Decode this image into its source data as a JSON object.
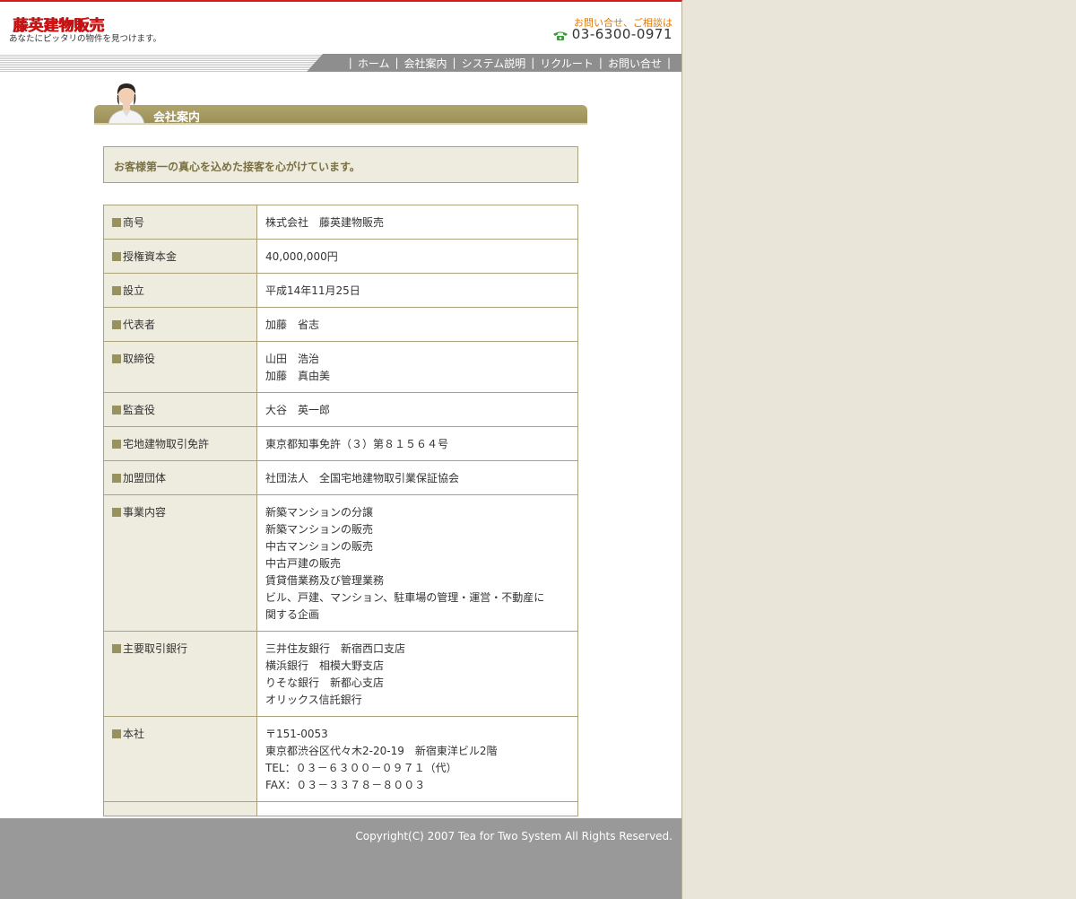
{
  "header": {
    "logo": "藤英建物販売",
    "tagline": "あなたにピッタリの物件を見つけます。",
    "contact_label": "お問い合せ、ご相談は",
    "phone": "03-6300-0971"
  },
  "nav": {
    "items": [
      {
        "label": "ホーム"
      },
      {
        "label": "会社案内"
      },
      {
        "label": "システム説明"
      },
      {
        "label": "リクルート"
      },
      {
        "label": "お問い合せ"
      }
    ]
  },
  "section": {
    "title": "会社案内",
    "intro": "お客様第一の真心を込めた接客を心がけています。"
  },
  "company": {
    "rows": [
      {
        "label": "商号",
        "lines": [
          "株式会社　藤英建物販売"
        ]
      },
      {
        "label": "授権資本金",
        "lines": [
          "40,000,000円"
        ]
      },
      {
        "label": "設立",
        "lines": [
          "平成14年11月25日"
        ]
      },
      {
        "label": "代表者",
        "lines": [
          "加藤　省志"
        ]
      },
      {
        "label": "取締役",
        "lines": [
          "山田　浩治",
          "加藤　真由美"
        ]
      },
      {
        "label": "監査役",
        "lines": [
          "大谷　英一郎"
        ]
      },
      {
        "label": "宅地建物取引免許",
        "lines": [
          "東京都知事免許（３）第８１５６４号"
        ]
      },
      {
        "label": "加盟団体",
        "lines": [
          "社団法人　全国宅地建物取引業保証協会"
        ]
      },
      {
        "label": "事業内容",
        "lines": [
          "新築マンションの分譲",
          "新築マンションの販売",
          "中古マンションの販売",
          "中古戸建の販売",
          "賃貸借業務及び管理業務",
          "ビル、戸建、マンション、駐車場の管理・運営・不動産に",
          "関する企画"
        ]
      },
      {
        "label": "主要取引銀行",
        "lines": [
          "三井住友銀行　新宿西口支店",
          "横浜銀行　相模大野支店",
          "りそな銀行　新都心支店",
          "オリックス信託銀行"
        ]
      },
      {
        "label": "本社",
        "lines": [
          "〒151-0053",
          "東京都渋谷区代々木2-20-19　新宿東洋ビル2階",
          "TEL：０３－６３００－０９７１（代）",
          "FAX：０３－３３７８－８００３"
        ]
      }
    ]
  },
  "footer": {
    "copyright": "Copyright(C) 2007 Tea for Two System All Rights Reserved."
  },
  "colors": {
    "accent_red": "#d11313",
    "olive": "#9b9058",
    "contact_orange": "#e07700",
    "footer_gray": "#999999"
  }
}
